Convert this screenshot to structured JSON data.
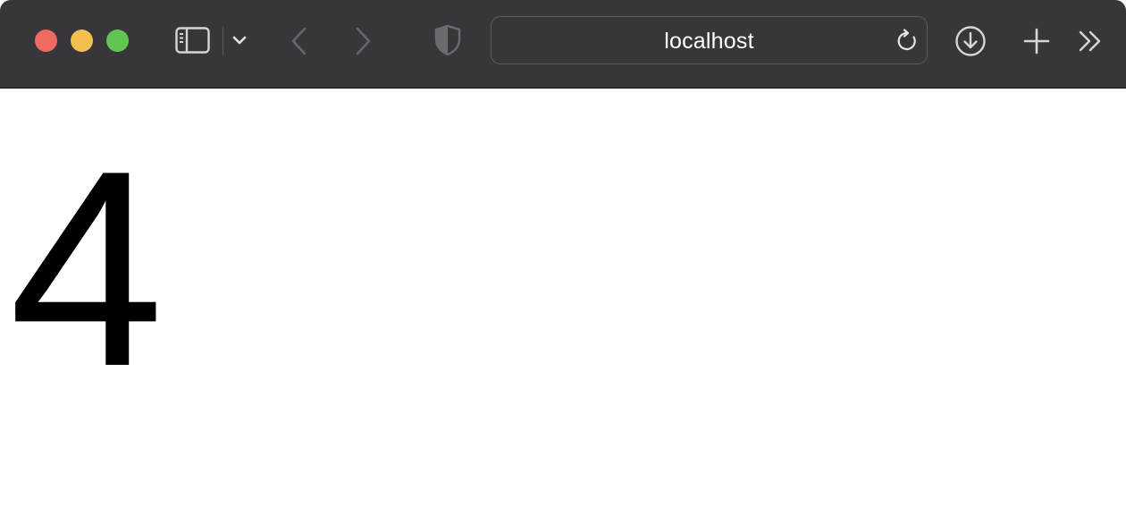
{
  "browser": {
    "address": {
      "url_text": "localhost"
    },
    "toolbar_icons": [
      "sidebar-icon",
      "chevron-down-icon",
      "back-arrow-icon",
      "forward-arrow-icon",
      "shield-icon",
      "reload-icon",
      "download-icon",
      "plus-icon",
      "double-chevron-right-icon"
    ],
    "colors": {
      "toolbar_bg": "#38363b",
      "close": "#ee6a5e",
      "minimize": "#f5bf4f",
      "zoom": "#61c554"
    }
  },
  "page": {
    "main_text": "4"
  }
}
